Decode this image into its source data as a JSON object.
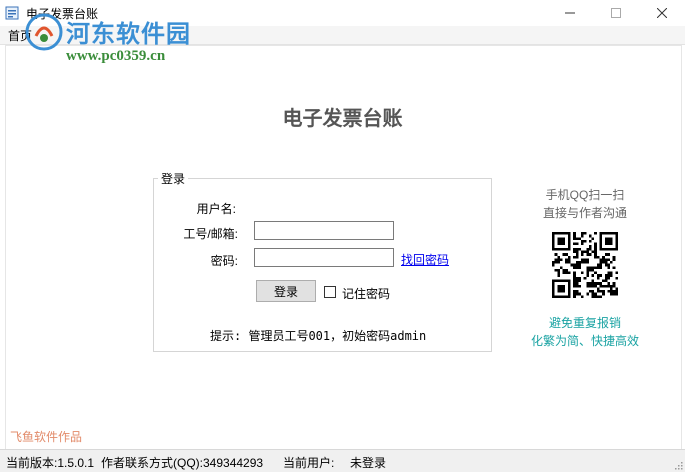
{
  "window": {
    "title": "电子发票台账"
  },
  "menu": {
    "items": [
      "首页"
    ]
  },
  "watermark": {
    "title": "河东软件园",
    "url": "www.pc0359.cn"
  },
  "main": {
    "heading": "电子发票台账",
    "login_group": {
      "legend": "登录",
      "username_label": "用户名:",
      "account_label": "工号/邮箱:",
      "account_value": "",
      "password_label": "密码:",
      "password_value": "",
      "retrieve_link": "找回密码",
      "login_button": "登录",
      "remember_label": "记住密码",
      "remember_checked": false,
      "hint": "提示: 管理员工号001，初始密码admin"
    },
    "side": {
      "qq_line1": "手机QQ扫一扫",
      "qq_line2": "直接与作者沟通",
      "slogan1": "避免重复报销",
      "slogan2": "化繁为简、快捷高效"
    },
    "credit": "飞鱼软件作品"
  },
  "status": {
    "version": "当前版本:1.5.0.1",
    "contact": "作者联系方式(QQ):349344293",
    "user_label": "当前用户:",
    "user_value": "未登录"
  },
  "colors": {
    "accent_teal": "#1aa3a3",
    "credit": "#e28b6a",
    "link": "#0000ee"
  }
}
